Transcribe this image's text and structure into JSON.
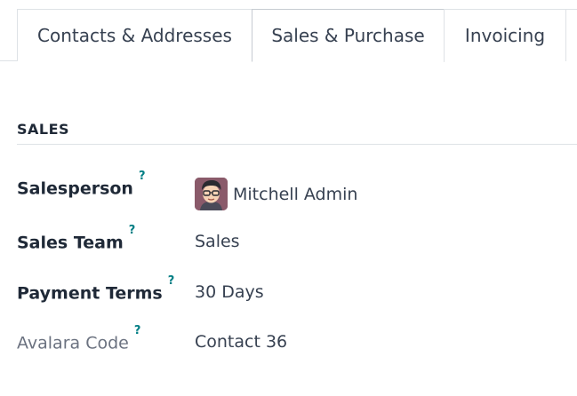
{
  "tabs": [
    {
      "label": "Contacts & Addresses",
      "active": false
    },
    {
      "label": "Sales & Purchase",
      "active": true
    },
    {
      "label": "Invoicing",
      "active": false
    }
  ],
  "section": {
    "title": "SALES"
  },
  "help_mark": "?",
  "fields": {
    "salesperson": {
      "label": "Salesperson",
      "value": "Mitchell Admin"
    },
    "sales_team": {
      "label": "Sales Team",
      "value": "Sales"
    },
    "payment_terms": {
      "label": "Payment Terms",
      "value": "30 Days"
    },
    "avalara_code": {
      "label": "Avalara Code",
      "value": "Contact 36"
    }
  },
  "colors": {
    "help": "#017e84",
    "border": "#dee2e6"
  },
  "icons": {
    "avatar": "user-avatar-icon"
  }
}
